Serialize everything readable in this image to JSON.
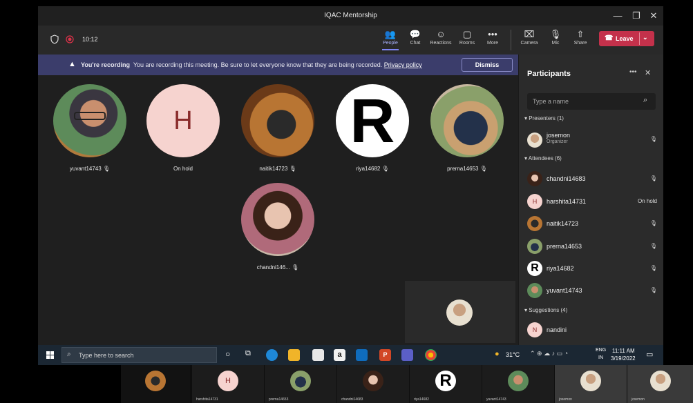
{
  "window": {
    "title": "IQAC Mentorship",
    "minimize": "—",
    "restore": "❐",
    "close": "✕"
  },
  "meeting": {
    "timer": "10:12"
  },
  "toolbar": {
    "items": [
      {
        "icon": "people-icon",
        "glyph": "👥",
        "label": "People"
      },
      {
        "icon": "chat-icon",
        "glyph": "💬",
        "label": "Chat"
      },
      {
        "icon": "reactions-icon",
        "glyph": "☺",
        "label": "Reactions"
      },
      {
        "icon": "rooms-icon",
        "glyph": "▢",
        "label": "Rooms"
      },
      {
        "icon": "more-icon",
        "glyph": "•••",
        "label": "More"
      },
      {
        "icon": "camera-off-icon",
        "glyph": "⌧",
        "label": "Camera"
      },
      {
        "icon": "mic-off-icon",
        "glyph": "🎙",
        "label": "Mic"
      },
      {
        "icon": "share-icon",
        "glyph": "⇧",
        "label": "Share"
      }
    ],
    "leave_label": "Leave"
  },
  "banner": {
    "title": "You're recording",
    "message": "You are recording this meeting. Be sure to let everyone know that they are being recorded.",
    "link": "Privacy policy",
    "dismiss_label": "Dismiss"
  },
  "stage": {
    "tiles": [
      {
        "name": "yuvant14743",
        "initial": ""
      },
      {
        "name": "On hold",
        "initial": "H"
      },
      {
        "name": "naitik14723",
        "initial": ""
      },
      {
        "name": "riya14682",
        "initial": "R"
      },
      {
        "name": "prerna14653",
        "initial": ""
      },
      {
        "name": "chandni146...",
        "initial": ""
      }
    ]
  },
  "panel": {
    "title": "Participants",
    "search_placeholder": "Type a name",
    "presenters_header": "Presenters (1)",
    "presenters": [
      {
        "name": "josemon",
        "role": "Organizer"
      }
    ],
    "attendees_header": "Attendees (6)",
    "attendees": [
      {
        "name": "chandni14683",
        "status": ""
      },
      {
        "name": "harshita14731",
        "status": "On hold",
        "initial": "H"
      },
      {
        "name": "naitik14723",
        "status": ""
      },
      {
        "name": "prerna14653",
        "status": ""
      },
      {
        "name": "riya14682",
        "status": "",
        "initial": "R"
      },
      {
        "name": "yuvant14743",
        "status": ""
      }
    ],
    "suggestions_header": "Suggestions (4)",
    "suggestions": [
      {
        "name": "nandini",
        "initial": "N"
      }
    ]
  },
  "taskbar": {
    "search_placeholder": "Type here to search",
    "weather": "31°C",
    "lang_top": "ENG",
    "lang_bottom": "IN",
    "time": "11:11 AM",
    "date": "3/19/2022"
  },
  "strip": {
    "thumbs": [
      {
        "name": "",
        "initial": ""
      },
      {
        "name": "harshita14731",
        "initial": "H"
      },
      {
        "name": "prerna14653",
        "initial": ""
      },
      {
        "name": "chandni14683",
        "initial": ""
      },
      {
        "name": "riya14682",
        "initial": "R"
      },
      {
        "name": "yuvant14743",
        "initial": ""
      },
      {
        "name": "josemon",
        "initial": ""
      },
      {
        "name": "josemon",
        "initial": ""
      }
    ]
  },
  "colors": {
    "accent": "#7f85f5",
    "leave": "#c4314b",
    "banner": "#3b3d6b",
    "recording": "#e0324a"
  }
}
